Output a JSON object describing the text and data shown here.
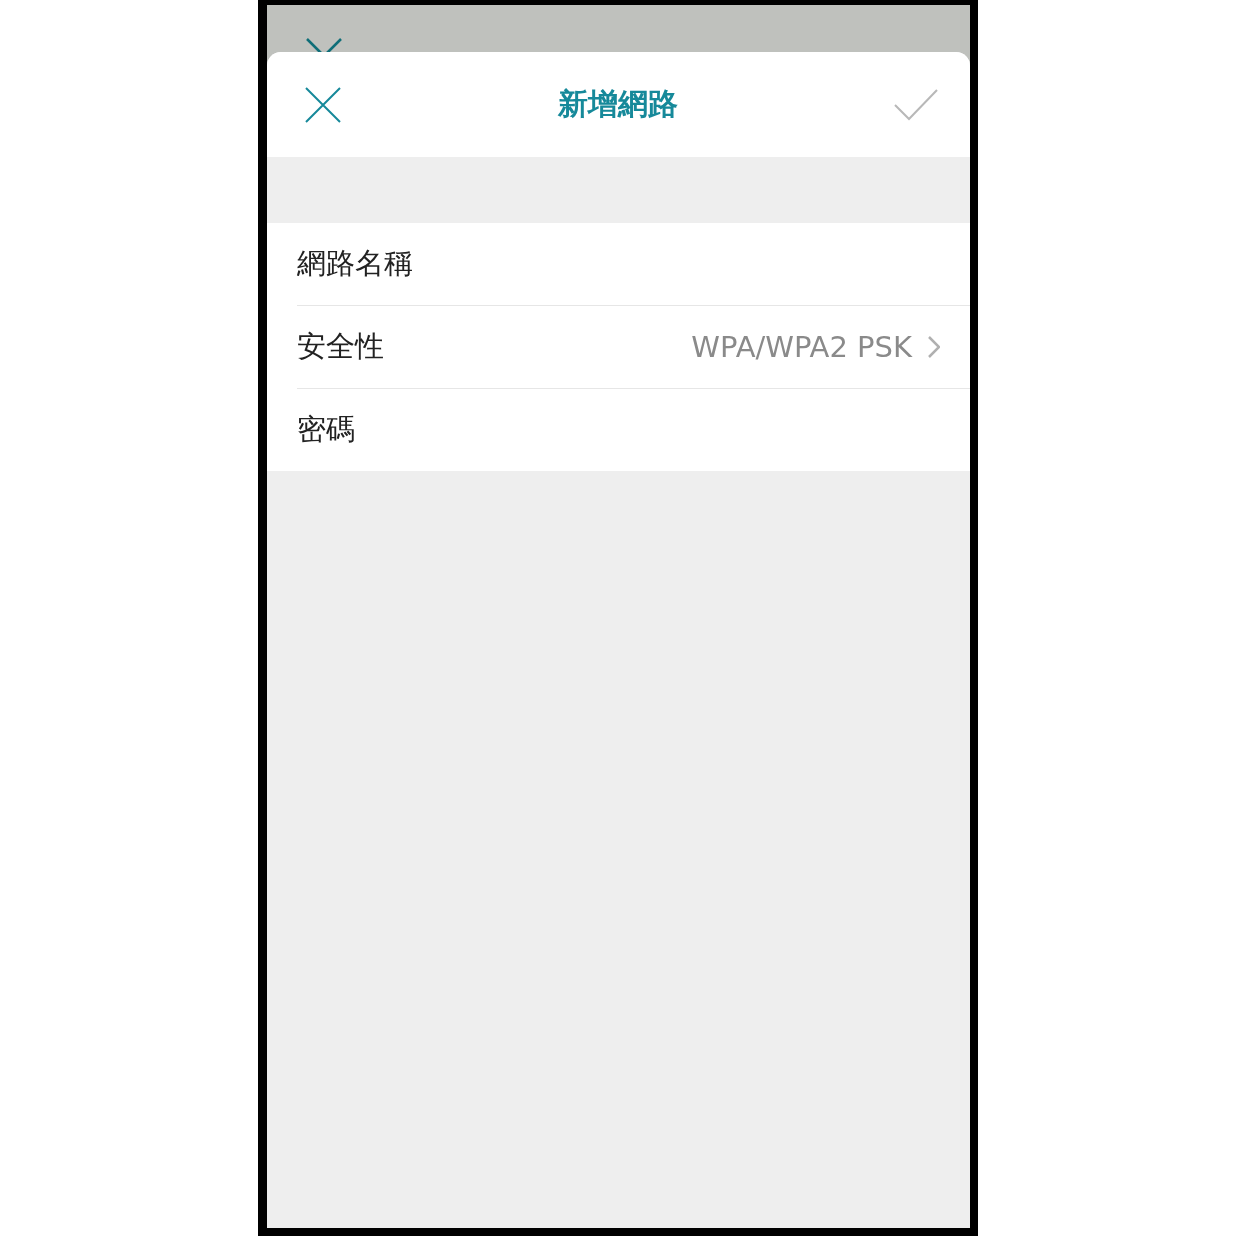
{
  "sheet": {
    "title": "新增網路"
  },
  "fields": [
    {
      "label": "網路名稱"
    },
    {
      "label": "安全性",
      "value": "WPA/WPA2 PSK"
    },
    {
      "label": "密碼"
    }
  ]
}
